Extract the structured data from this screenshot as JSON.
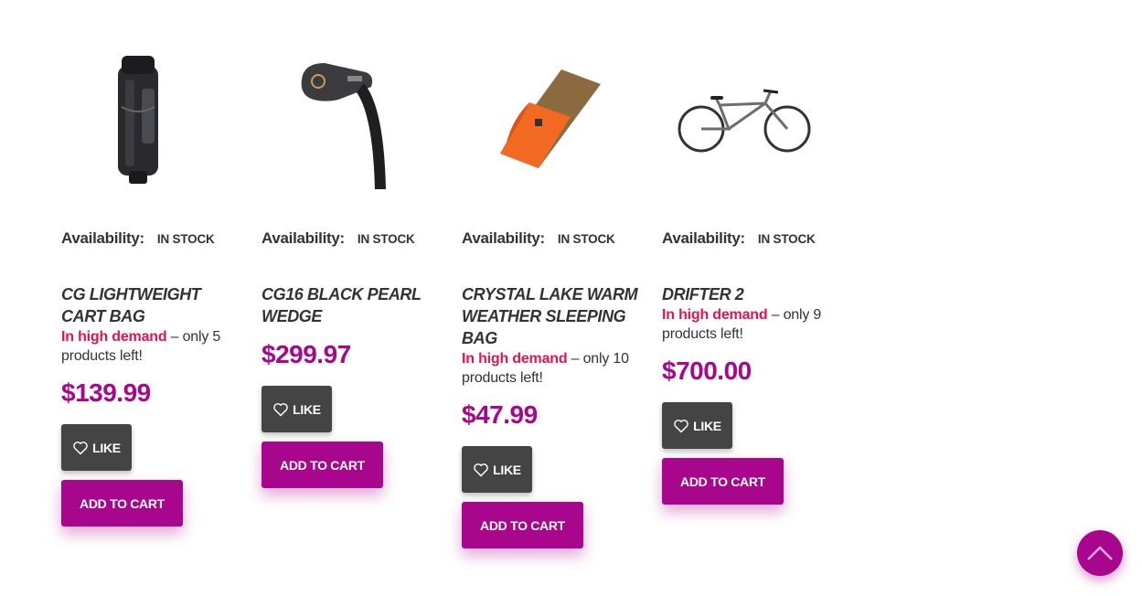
{
  "products": [
    {
      "image": "golf-cart-bag",
      "availability_label": "Availability:",
      "availability_value": "IN STOCK",
      "title": "CG LIGHTWEIGHT CART BAG",
      "demand_hot": "In high demand",
      "demand_rest": " – only 5 products left!",
      "price": "$139.99",
      "like_label": "LIKE",
      "cart_label": "ADD TO CART"
    },
    {
      "image": "golf-wedge",
      "availability_label": "Availability:",
      "availability_value": "IN STOCK",
      "title": "CG16 BLACK PEARL WEDGE",
      "demand_hot": "",
      "demand_rest": "",
      "price": "$299.97",
      "like_label": "LIKE",
      "cart_label": "ADD TO CART"
    },
    {
      "image": "sleeping-bag",
      "availability_label": "Availability:",
      "availability_value": "IN STOCK",
      "title": "CRYSTAL LAKE WARM WEATHER SLEEPING BAG",
      "demand_hot": "In high demand",
      "demand_rest": " – only 10 products left!",
      "price": "$47.99",
      "like_label": "LIKE",
      "cart_label": "ADD TO CART"
    },
    {
      "image": "bicycle",
      "availability_label": "Availability:",
      "availability_value": "IN STOCK",
      "title": "DRIFTER 2",
      "demand_hot": "In high demand",
      "demand_rest": " – only 9 products left!",
      "price": "$700.00",
      "like_label": "LIKE",
      "cart_label": "ADD TO CART"
    }
  ],
  "colors": {
    "accent": "#a8068c",
    "demand": "#e6124e",
    "like_bg": "#444444"
  },
  "scroll_top_icon": "chevron-up-icon"
}
